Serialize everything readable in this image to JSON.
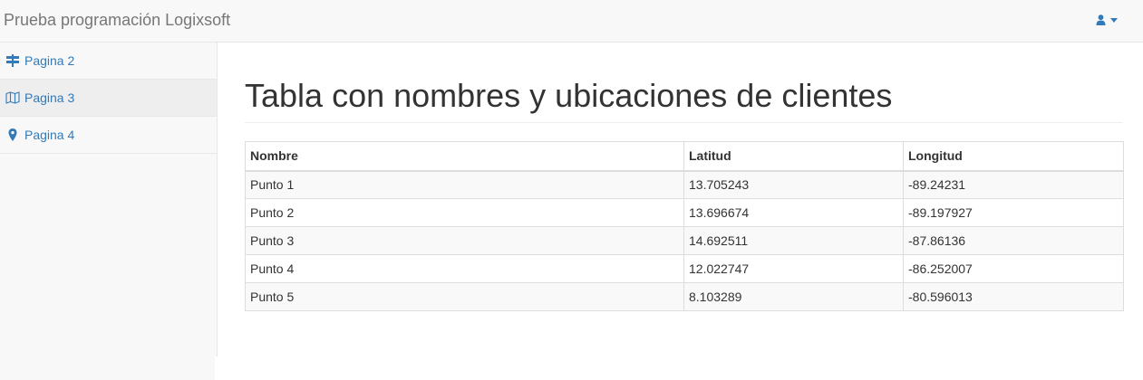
{
  "navbar": {
    "brand": "Prueba programación Logixsoft",
    "user_icon": "user-icon",
    "caret_icon": "caret-down-icon"
  },
  "sidebar": {
    "items": [
      {
        "label": "Pagina 2",
        "icon": "signpost-icon",
        "active": false
      },
      {
        "label": "Pagina 3",
        "icon": "map-icon",
        "active": true
      },
      {
        "label": "Pagina 4",
        "icon": "map-marker-icon",
        "active": false
      }
    ]
  },
  "main": {
    "title": "Tabla con nombres y ubicaciones de clientes",
    "table": {
      "headers": [
        "Nombre",
        "Latitud",
        "Longitud"
      ],
      "rows": [
        [
          "Punto 1",
          "13.705243",
          "-89.24231"
        ],
        [
          "Punto 2",
          "13.696674",
          "-89.197927"
        ],
        [
          "Punto 3",
          "14.692511",
          "-87.86136"
        ],
        [
          "Punto 4",
          "12.022747",
          "-86.252007"
        ],
        [
          "Punto 5",
          "8.103289",
          "-80.596013"
        ]
      ]
    }
  },
  "colors": {
    "link": "#337ab7",
    "navbar_bg": "#f8f8f8",
    "brand_text": "#777777",
    "active_item_bg": "#eeeeee",
    "striped_row": "#f9f9f9",
    "border": "#dddddd"
  }
}
